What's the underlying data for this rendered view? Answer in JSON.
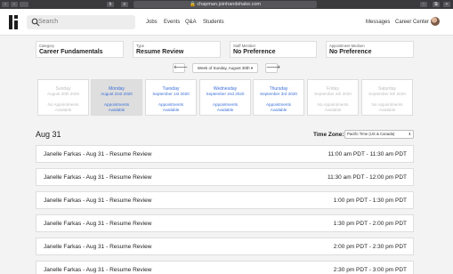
{
  "browser": {
    "url": "chapman.joinhandshake.com"
  },
  "nav": {
    "search_placeholder": "Search",
    "links": [
      "Jobs",
      "Events",
      "Q&A",
      "Students"
    ],
    "right_links": [
      "Messages",
      "Career Center"
    ]
  },
  "filters": [
    {
      "label": "Category",
      "value": "Career Fundamentals"
    },
    {
      "label": "Type",
      "value": "Resume Review"
    },
    {
      "label": "Staff Member",
      "value": "No Preference"
    },
    {
      "label": "Appointment Medium",
      "value": "No Preference"
    }
  ],
  "week": {
    "prev": "🡐",
    "label": "Week of Sunday, August 30th ▾",
    "next": "🡒"
  },
  "days": [
    {
      "name": "Sunday",
      "date": "August 30th 2020",
      "status1": "No Appointments",
      "status2": "Available"
    },
    {
      "name": "Monday",
      "date": "August 31st 2020",
      "status1": "Appointments",
      "status2": "Available"
    },
    {
      "name": "Tuesday",
      "date": "September 1st 2020",
      "status1": "Appointments",
      "status2": "Available"
    },
    {
      "name": "Wednesday",
      "date": "September 2nd 2020",
      "status1": "Appointments",
      "status2": "Available"
    },
    {
      "name": "Thursday",
      "date": "September 3rd 2020",
      "status1": "Appointments",
      "status2": "Available"
    },
    {
      "name": "Friday",
      "date": "September 4th 2020",
      "status1": "No Appointments",
      "status2": "Available"
    },
    {
      "name": "Saturday",
      "date": "September 5th 2020",
      "status1": "No Appointments",
      "status2": "Available"
    }
  ],
  "schedule": {
    "date_heading": "Aug 31",
    "timezone_label": "Time Zone:",
    "timezone_value": "Pacific Time (US & Canada)",
    "slots": [
      {
        "name": "Janelle Farkas - Aug 31 - Resume Review",
        "time": "11:00 am PDT - 11:30 am PDT"
      },
      {
        "name": "Janelle Farkas - Aug 31 - Resume Review",
        "time": "11:30 am PDT - 12:00 pm PDT"
      },
      {
        "name": "Janelle Farkas - Aug 31 - Resume Review",
        "time": "1:00 pm PDT - 1:30 pm PDT"
      },
      {
        "name": "Janelle Farkas - Aug 31 - Resume Review",
        "time": "1:30 pm PDT - 2:00 pm PDT"
      },
      {
        "name": "Janelle Farkas - Aug 31 - Resume Review",
        "time": "2:00 pm PDT - 2:30 pm PDT"
      },
      {
        "name": "Janelle Farkas - Aug 31 - Resume Review",
        "time": "2:30 pm PDT - 3:00 pm PDT"
      }
    ]
  },
  "colors": {
    "link_blue": "#3a6fd8",
    "disabled_text": "#bcbcbc",
    "selected_day_bg": "#dedede"
  }
}
